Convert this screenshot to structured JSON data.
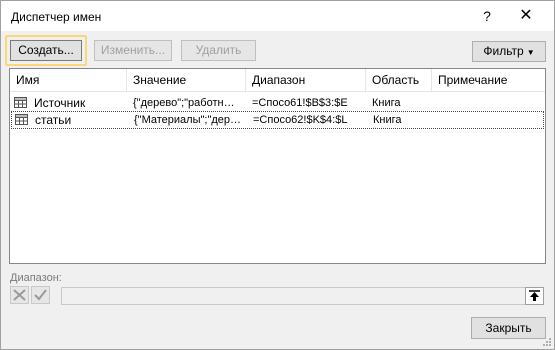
{
  "window": {
    "title": "Диспетчер имен",
    "help_glyph": "?",
    "close_glyph": "✕"
  },
  "toolbar": {
    "create_label": "Создать...",
    "edit_label": "Изменить...",
    "delete_label": "Удалить",
    "filter_label": "Фильтр"
  },
  "table": {
    "columns": [
      "Имя",
      "Значение",
      "Диапазон",
      "Область",
      "Примечание"
    ],
    "rows": [
      {
        "name": "Источник",
        "value": "{\"дерево\";\"работн…",
        "range": "=Спосо61!$B$3:$E",
        "scope": "Книга",
        "note": "",
        "icon": "named-range-icon",
        "selected": false
      },
      {
        "name": "статьи",
        "value": "{\"Материалы\";\"дер…",
        "range": "=Спосо62!$K$4:$L",
        "scope": "Книга",
        "note": "",
        "icon": "named-range-icon",
        "selected": true
      }
    ]
  },
  "range_editor": {
    "label": "Диапазон:",
    "value": "",
    "cancel_icon": "cancel-x-icon",
    "confirm_icon": "check-icon",
    "collapse_icon": "collapse-arrow-icon"
  },
  "footer": {
    "close_label": "Закрыть"
  },
  "colors": {
    "focus_highlight": "#f8d87a",
    "disabled_text": "#a0a0a0",
    "grid_border": "#828790"
  }
}
